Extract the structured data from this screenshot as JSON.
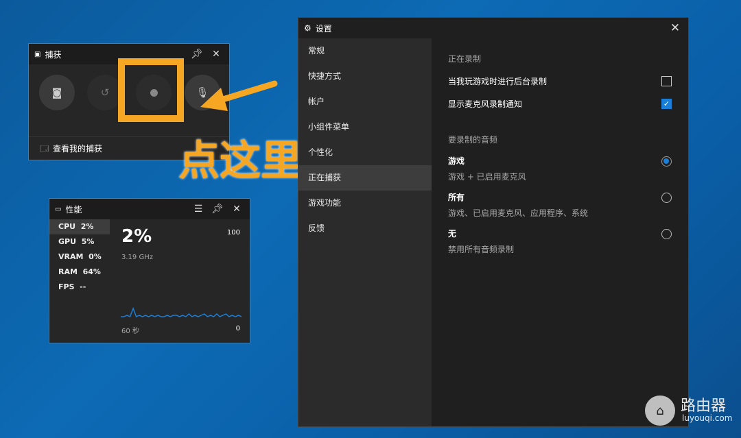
{
  "capture": {
    "title": "捕获",
    "view_captures": "查看我的捕获"
  },
  "performance": {
    "title": "性能",
    "stats": [
      {
        "label": "CPU",
        "value": "2%"
      },
      {
        "label": "GPU",
        "value": "5%"
      },
      {
        "label": "VRAM",
        "value": "0%"
      },
      {
        "label": "RAM",
        "value": "64%"
      },
      {
        "label": "FPS",
        "value": "--"
      }
    ],
    "big_value": "2%",
    "freq": "3.19 GHz",
    "max": "100",
    "min": "0",
    "duration": "60 秒",
    "cpu_history": [
      2,
      2,
      3,
      2,
      8,
      2,
      3,
      2,
      3,
      2,
      3,
      2,
      3,
      2,
      2,
      3,
      2,
      3,
      3,
      2,
      3,
      2,
      4,
      2,
      3,
      2,
      3,
      4,
      2,
      3,
      2,
      4,
      2,
      3,
      4,
      2,
      3,
      2,
      3,
      2
    ]
  },
  "settings": {
    "title": "设置",
    "nav": [
      "常规",
      "快捷方式",
      "帐户",
      "小组件菜单",
      "个性化",
      "正在捕获",
      "游戏功能",
      "反馈"
    ],
    "selected_nav": "正在捕获",
    "section_recording": "正在录制",
    "bg_recording": "当我玩游戏时进行后台录制",
    "bg_recording_checked": false,
    "mic_notify": "显示麦克风录制通知",
    "mic_notify_checked": true,
    "section_audio": "要录制的音频",
    "options": [
      {
        "title": "游戏",
        "desc": "游戏 + 已启用麦克风",
        "selected": true
      },
      {
        "title": "所有",
        "desc": "游戏、已启用麦克风、应用程序、系统",
        "selected": false
      },
      {
        "title": "无",
        "desc": "禁用所有音频录制",
        "selected": false
      }
    ]
  },
  "annotation": {
    "text": "点这里",
    "color": "#f5a623"
  },
  "watermark": {
    "title": "路由器",
    "url": "luyouqi.com"
  }
}
